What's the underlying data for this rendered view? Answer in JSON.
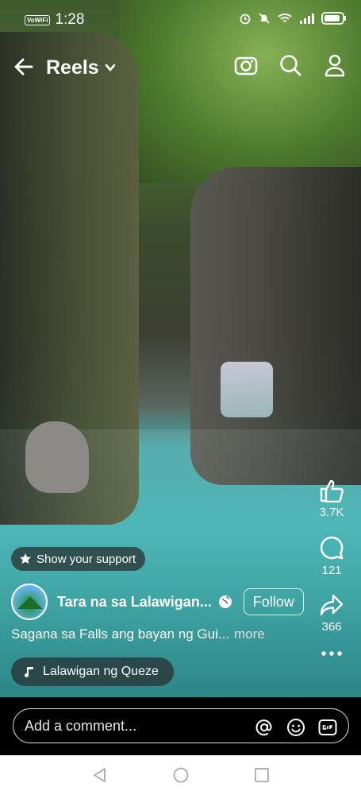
{
  "status": {
    "time": "1:28",
    "network_label": "VoWiFi"
  },
  "header": {
    "title": "Reels"
  },
  "actions": {
    "like_count": "3.7K",
    "comment_count": "121",
    "share_count": "366"
  },
  "post": {
    "support_label": "Show your support",
    "page_name": "Tara na sa Lalawigan...",
    "follow_label": "Follow",
    "caption": "Sagana sa Falls ang bayan ng Gui...",
    "more_label": "more",
    "audio_label": "Lalawigan ng Queze"
  },
  "comment": {
    "placeholder": "Add a comment..."
  },
  "colors": {
    "accent": "#ffffff",
    "water": "#45b7b6",
    "nav_bg": "#ffffff"
  },
  "icons": [
    "back-arrow-icon",
    "chevron-down-icon",
    "camera-icon",
    "search-icon",
    "profile-icon",
    "like-icon",
    "comment-icon",
    "share-icon",
    "more-icon",
    "star-icon",
    "globe-icon",
    "music-icon",
    "at-icon",
    "emoji-icon",
    "gif-icon",
    "nav-back-icon",
    "nav-home-icon",
    "nav-recents-icon"
  ]
}
